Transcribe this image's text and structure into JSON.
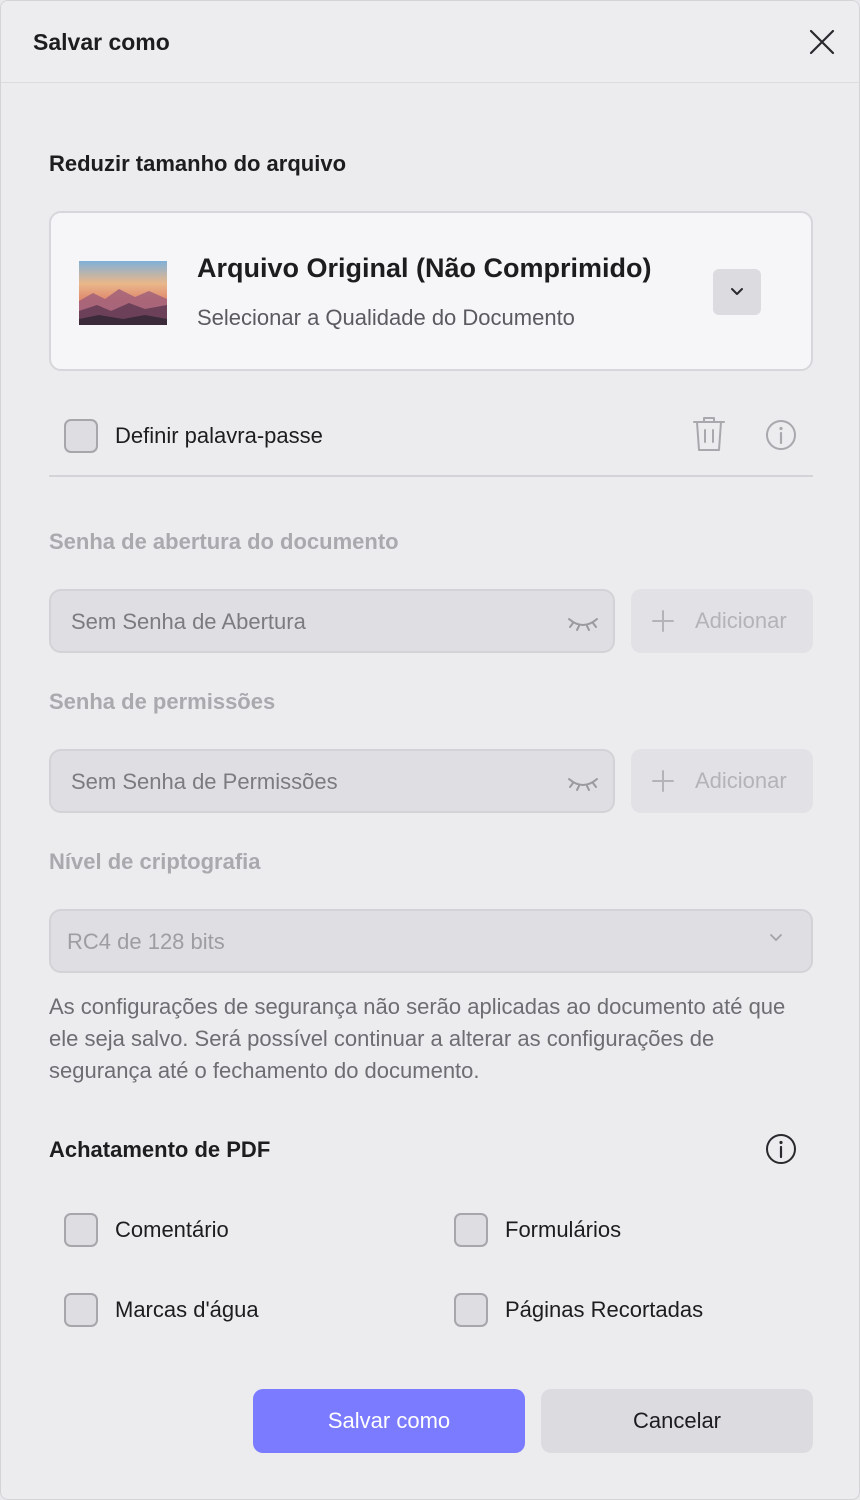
{
  "dialog": {
    "title": "Salvar como"
  },
  "compression": {
    "heading": "Reduzir tamanho do arquivo",
    "option_title": "Arquivo Original (Não Comprimido)",
    "option_subtitle": "Selecionar a Qualidade do Documento"
  },
  "password": {
    "checkbox_label": "Definir palavra-passe",
    "checked": false,
    "open_heading": "Senha de abertura do documento",
    "open_value": "Sem Senha de Abertura",
    "open_add_label": "Adicionar",
    "permissions_heading": "Senha de permissões",
    "permissions_value": "Sem Senha de Permissões",
    "permissions_add_label": "Adicionar",
    "encryption_heading": "Nível de criptografia",
    "encryption_value": "RC4 de 128 bits",
    "note": "As configurações de segurança não serão aplicadas ao documento até que ele seja salvo. Será possível continuar a alterar as configurações de segurança até o fechamento do documento."
  },
  "flatten": {
    "heading": "Achatamento de PDF",
    "options": [
      {
        "label": "Comentário",
        "checked": false
      },
      {
        "label": "Formulários",
        "checked": false
      },
      {
        "label": "Marcas d'água",
        "checked": false
      },
      {
        "label": "Páginas Recortadas",
        "checked": false
      }
    ]
  },
  "buttons": {
    "save": "Salvar como",
    "cancel": "Cancelar"
  },
  "colors": {
    "primary": "#7b7bff",
    "background": "#ececef"
  },
  "icons": [
    "close-icon",
    "chevron-down-icon",
    "trash-icon",
    "info-icon",
    "eye-closed-icon",
    "plus-icon"
  ]
}
